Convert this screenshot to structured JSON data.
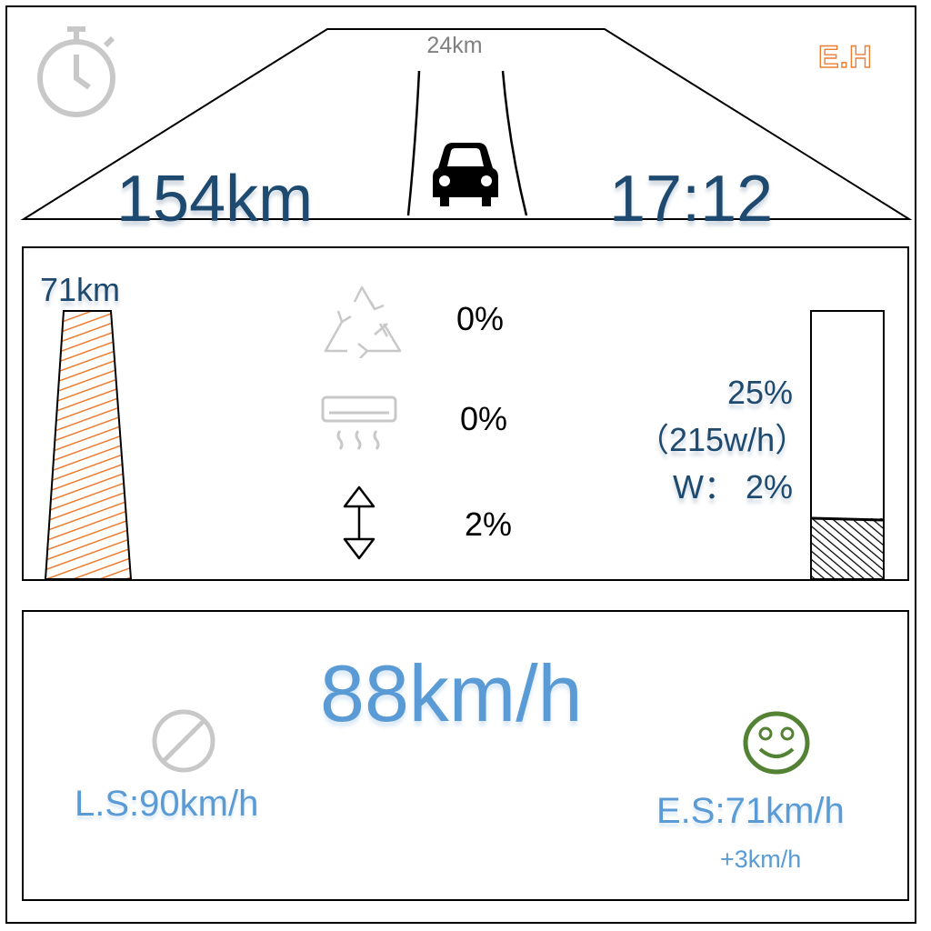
{
  "top": {
    "distance_ahead": "24km",
    "total_distance": "154km",
    "clock_time": "17:12",
    "profile_badge": "E.H",
    "icons": {
      "timer": "stopwatch-icon",
      "vehicle": "car-icon"
    }
  },
  "middle": {
    "battery_range": "71km",
    "battery_level_fraction": 1.0,
    "consumption": [
      {
        "icon": "recycle-icon",
        "value": "0%"
      },
      {
        "icon": "air-conditioner-icon",
        "value": "0%"
      },
      {
        "icon": "up-down-arrow-icon",
        "value": "2%"
      }
    ],
    "power_percent": "25%",
    "power_rate": "（215w/h）",
    "power_w": "W： 2%",
    "power_level_fraction": 0.25
  },
  "bottom": {
    "speed": "88km/h",
    "limit_speed": "L.S:90km/h",
    "eco_speed": "E.S:71km/h",
    "eco_delta": "+3km/h",
    "icons": {
      "limit": "no-entry-icon",
      "eco": "smiley-icon"
    }
  },
  "colors": {
    "dark_blue": "#1f4a70",
    "light_blue": "#5b9bd5",
    "orange": "#ed7d31",
    "green": "#548235",
    "gray_icon": "#c8c8c8"
  }
}
